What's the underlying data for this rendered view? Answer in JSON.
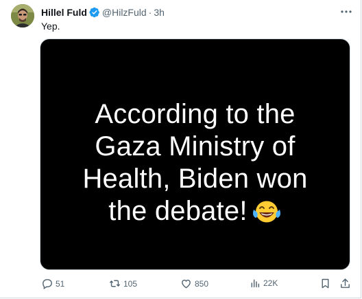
{
  "tweet": {
    "author_name": "Hillel Fuld",
    "handle": "@HilzFuld",
    "separator": "·",
    "time": "3h",
    "text": "Yep.",
    "verified": true,
    "more_icon": "more-horizontal-icon",
    "media": {
      "lines": [
        "According to the",
        "Gaza Ministry of",
        "Health, Biden won",
        "the debate!"
      ],
      "emoji": "😂",
      "background": "#000000",
      "text_color": "#ffffff"
    },
    "actions": {
      "replies": "51",
      "reposts": "105",
      "likes": "850",
      "views": "22K"
    }
  },
  "colors": {
    "accent": "#1d9bf0",
    "muted": "#536471",
    "text": "#0f1419",
    "border": "#cfd9de"
  }
}
